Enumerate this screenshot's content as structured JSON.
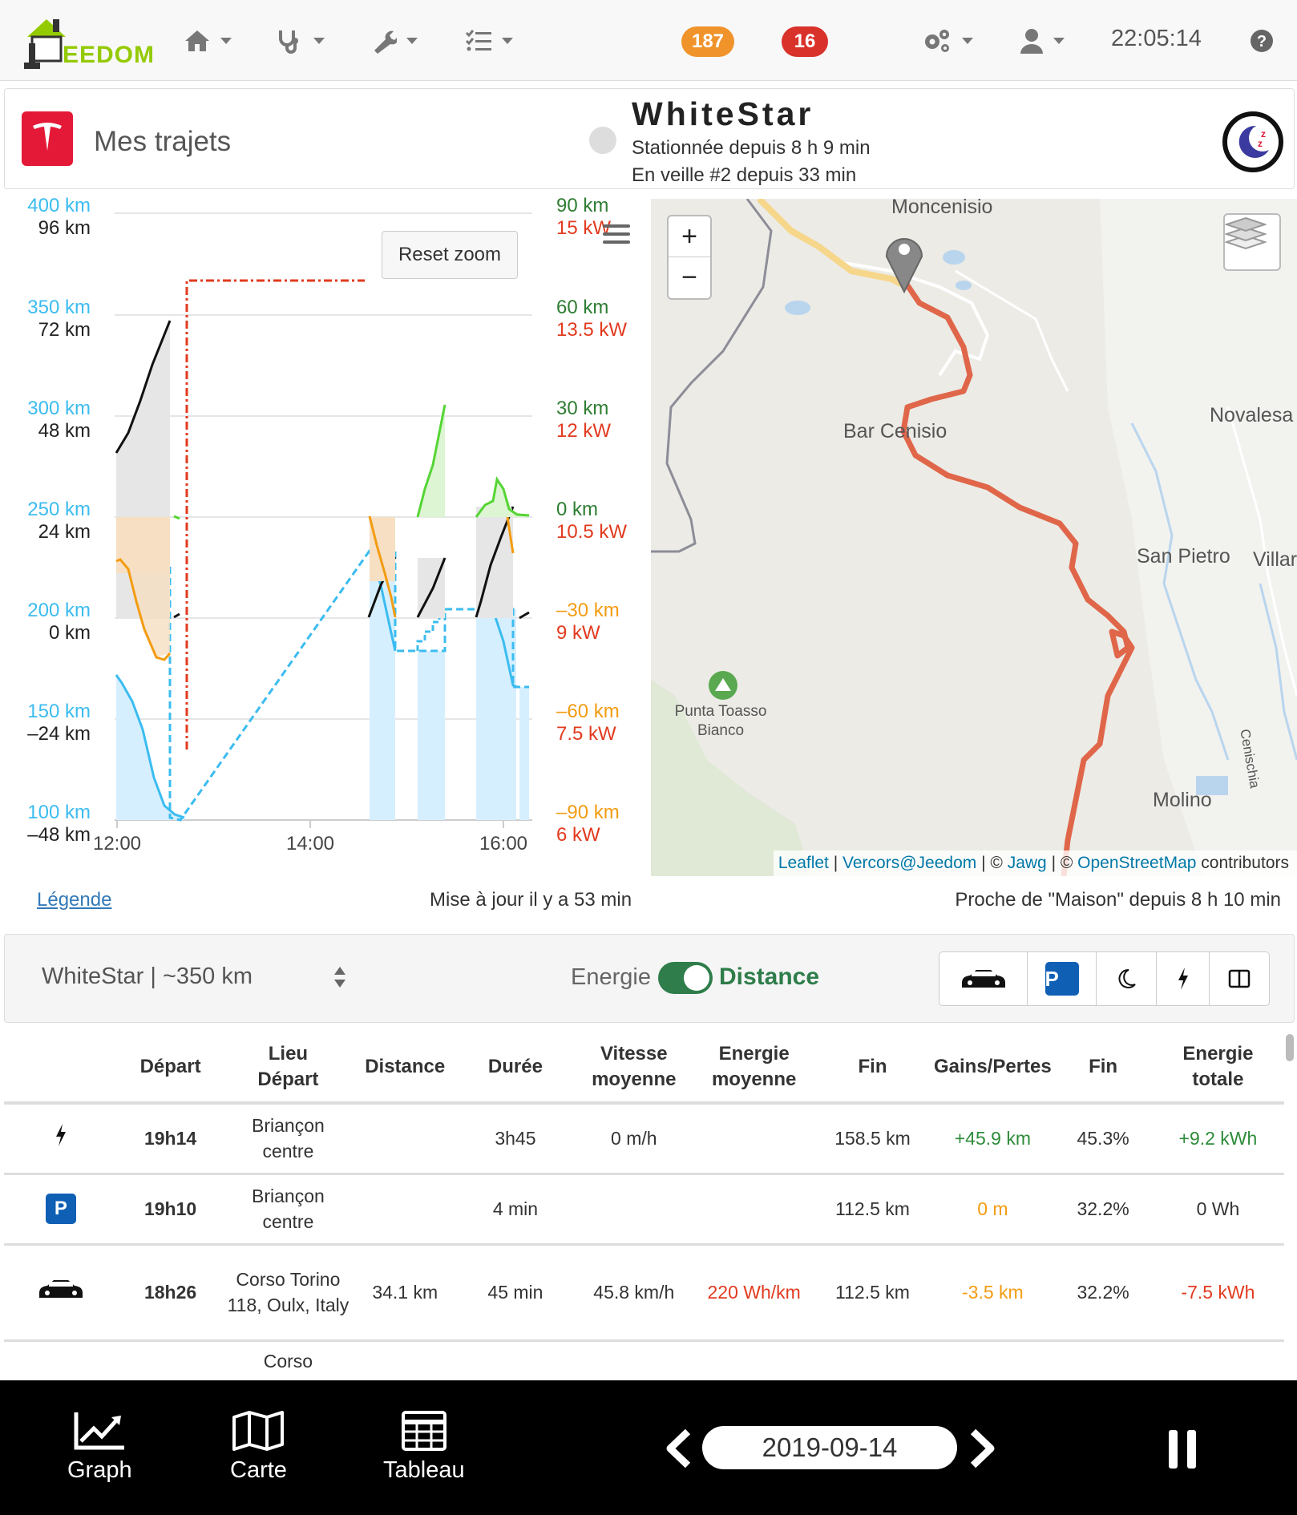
{
  "navbar": {
    "logo_text": "EEDOM",
    "badge_orange": "187",
    "badge_red": "16",
    "clock": "22:05:14",
    "colors": {
      "badge_orange": "#f0932b",
      "badge_red": "#d9322b",
      "logo_green": "#94ca02"
    },
    "icons": [
      "home-icon",
      "stethoscope-icon",
      "wrench-icon",
      "tasks-icon",
      "cogs-icon",
      "user-icon",
      "help-icon"
    ]
  },
  "header": {
    "title": "Mes trajets",
    "car_name": "WhiteStar",
    "status_line1": "Stationnée depuis 8 h 9 min",
    "status_line2": "En veille #2 depuis 33 min",
    "tesla_color": "#e31937"
  },
  "chart": {
    "reset_zoom": "Reset zoom",
    "y_left_range": [
      "400 km",
      "350 km",
      "300 km",
      "250 km",
      "200 km",
      "150 km",
      "100 km"
    ],
    "y_left_dist": [
      "96 km",
      "72 km",
      "48 km",
      "24 km",
      "0 km",
      "–24 km",
      "–48 km"
    ],
    "y_right_km": [
      "90 km",
      "60 km",
      "30 km",
      "0 km",
      "–30 km",
      "–60 km",
      "–90 km"
    ],
    "y_right_kw": [
      "15 kW",
      "13.5 kW",
      "12 kW",
      "10.5 kW",
      "9 kW",
      "7.5 kW",
      "6 kW"
    ],
    "x_ticks": [
      "12:00",
      "14:00",
      "16:00"
    ]
  },
  "chart_data": {
    "type": "line",
    "x_ticks": [
      "12:00",
      "14:00",
      "16:00"
    ],
    "x_range": [
      "12:00",
      "16:20"
    ],
    "grid": true,
    "axes": {
      "left_range_km": {
        "ticks": [
          "400 km",
          "350 km",
          "300 km",
          "250 km",
          "200 km",
          "150 km",
          "100 km"
        ],
        "range": [
          100,
          400
        ],
        "color": "#3bbcf0"
      },
      "left_distance_km": {
        "ticks": [
          "96 km",
          "72 km",
          "48 km",
          "24 km",
          "0 km",
          "–24 km",
          "–48 km"
        ],
        "range": [
          -48,
          96
        ],
        "color": "#222222"
      },
      "right_gain_km": {
        "ticks": [
          "90 km",
          "60 km",
          "30 km",
          "0 km",
          "–30 km",
          "–60 km",
          "–90 km"
        ],
        "range": [
          -90,
          90
        ],
        "colors": {
          "positive": "#2e7d32",
          "negative": "#f39c12"
        }
      },
      "right_power_kw": {
        "ticks": [
          "15 kW",
          "13.5 kW",
          "12 kW",
          "10.5 kW",
          "9 kW",
          "7.5 kW",
          "6 kW"
        ],
        "range": [
          6,
          15
        ],
        "color": "#e23a1e"
      }
    },
    "series_colors": {
      "range": "#3bbcf0",
      "distance": "#111111",
      "loss": "#f39c12",
      "gain": "#55d535",
      "power": "#e23a1e"
    }
  },
  "map": {
    "labels": [
      "Moncenisio",
      "Bar Cenisio",
      "Novalesa",
      "San Pietro",
      "Villar",
      "Punta Toasso Bianco",
      "Molino",
      "Cenischia"
    ],
    "zoom_in": "+",
    "zoom_out": "−",
    "attribution": {
      "leaflet": "Leaflet",
      "sep1": " | ",
      "vercors": "Vercors@Jeedom",
      "sep2": " | © ",
      "jawg": "Jawg",
      "sep3": " | © ",
      "osm": "OpenStreetMap",
      "contributors": " contributors"
    },
    "route_color": "#e0664a"
  },
  "info": {
    "legend": "Légende",
    "update": "Mise à jour il y a 53 min",
    "proximity": "Proche de \"Maison\" depuis 8 h 10 min"
  },
  "controls": {
    "car_select": "WhiteStar | ~350 km",
    "toggle_off_label": "Energie",
    "toggle_on_label": "Distance",
    "filter_buttons": [
      "car-filter-icon",
      "parking-filter-icon",
      "sleep-filter-icon",
      "charge-filter-icon",
      "columns-icon"
    ],
    "parking_label": "P"
  },
  "table": {
    "headers": [
      "",
      "Départ",
      "Lieu\nDépart",
      "Distance",
      "Durée",
      "Vitesse\nmoyenne",
      "Energie\nmoyenne",
      "Fin",
      "Gains/Pertes",
      "Fin",
      "Energie\ntotale"
    ],
    "rows": [
      {
        "type": "charge",
        "depart": "19h14",
        "lieu": "Briançon centre",
        "distance": "",
        "duree": "3h45",
        "vitesse": "0 m/h",
        "energie_moy": "",
        "fin_km": "158.5 km",
        "gains": "+45.9 km",
        "fin_pct": "45.3%",
        "energie_tot": "+9.2 kWh"
      },
      {
        "type": "park",
        "depart": "19h10",
        "lieu": "Briançon centre",
        "distance": "",
        "duree": "4 min",
        "vitesse": "",
        "energie_moy": "",
        "fin_km": "112.5 km",
        "gains": "0 m",
        "fin_pct": "32.2%",
        "energie_tot": "0 Wh"
      },
      {
        "type": "drive",
        "depart": "18h26",
        "lieu": "Corso Torino 118, Oulx, Italy",
        "distance": "34.1 km",
        "duree": "45 min",
        "vitesse": "45.8 km/h",
        "energie_moy": "220 Wh/km",
        "fin_km": "112.5 km",
        "gains": "-3.5 km",
        "fin_pct": "32.2%",
        "energie_tot": "-7.5 kWh"
      },
      {
        "type": "drive",
        "depart": "",
        "lieu": "Corso",
        "distance": "",
        "duree": "",
        "vitesse": "",
        "energie_moy": "",
        "fin_km": "",
        "gains": "",
        "fin_pct": "",
        "energie_tot": ""
      }
    ]
  },
  "bottom": {
    "graph": "Graph",
    "carte": "Carte",
    "tableau": "Tableau",
    "date": "2019-09-14"
  }
}
